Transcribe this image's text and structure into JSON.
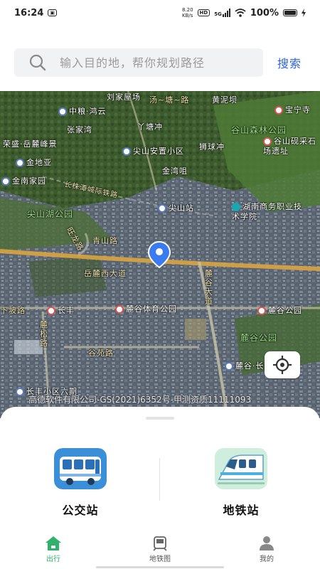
{
  "status_bar": {
    "time": "16:24",
    "speed_value": "8.20",
    "speed_unit": "KB/s",
    "hd_badge": "HD",
    "network": "5G",
    "battery_text": "100%"
  },
  "search": {
    "placeholder": "输入目的地，帮你规划路径",
    "button_label": "搜索"
  },
  "map": {
    "labels": {
      "liujia": "刘家屋场",
      "tangxu": "汤~塘~路",
      "huangni": "黄泥坝",
      "zhongliang": "中粮·鸿云",
      "baoning": "宝宁寺",
      "zhangjiawan": "张家湾",
      "yatang": "丫塘冲",
      "gushan_park": "谷山森林公园",
      "rongsheng": "荣盛·岳麓峰景",
      "jiandishan": "尖山安置小区",
      "shizichong": "狮球冲",
      "gushan_quarry": "谷山砚采石场遗址",
      "jindiya": "金地亚",
      "jinlongya": "金湾咀",
      "jinnan": "金南家园",
      "changzhutan": "长株潭城际铁路",
      "jianshan_station": "尖山站",
      "hunan_college": "湖南商务职业技术学院",
      "jianshanhu": "尖山湖公园",
      "wangyu": "旺龙路",
      "qingshan": "青山路",
      "yuelu_west": "岳麓西大道",
      "luguda": "麓谷大道",
      "changfeng": "长丰",
      "lugu_sports": "麓谷体育公园",
      "lugu_park_station": "麓谷公园",
      "xiapo": "下坡路",
      "lusong": "麓松路",
      "gushan_road": "谷苑路",
      "lugu_park": "麓谷公园",
      "changhai": "麓谷·长海",
      "changfeng_six": "长丰小区六期"
    },
    "copyright": "高德软件有限公司-GS(2021)6352号-甲测资质11111093"
  },
  "sheet": {
    "bus_label": "公交站",
    "metro_label": "地铁站"
  },
  "nav": {
    "travel": "出行",
    "metro_map": "地铁图",
    "mine": "我的"
  },
  "colors": {
    "accent_blue": "#2c63d6",
    "nav_active": "#2fb36c"
  },
  "icons": {
    "search": "search-icon",
    "locate": "crosshair-icon",
    "pin": "location-pin-icon",
    "bus": "bus-icon",
    "metro": "metro-train-icon",
    "home": "home-icon",
    "metro_map": "metro-map-icon",
    "user": "user-icon"
  }
}
